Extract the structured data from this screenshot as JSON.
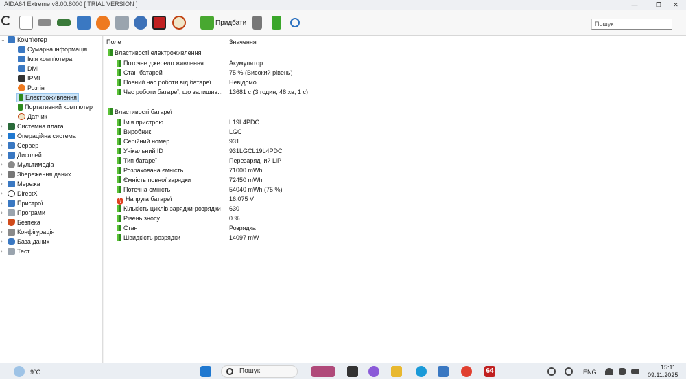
{
  "window": {
    "title": "AIDA64 Extreme v8.00.8000  [ TRIAL VERSION ]",
    "minimize": "—",
    "restore": "❐",
    "close": "✕"
  },
  "toolbar": {
    "add_label": "Придбати",
    "search_placeholder": "Пошук"
  },
  "tree": {
    "root": "Комп'ютер",
    "children": [
      "Сумарна інформація",
      "Ім'я комп'ютера",
      "DMI",
      "IPMI",
      "Розгін",
      "Електроживлення",
      "Портативний комп'ютер",
      "Датчик"
    ],
    "sections": [
      "Системна плата",
      "Операційна система",
      "Сервер",
      "Дисплей",
      "Мультимедіа",
      "Збереження даних",
      "Мережа",
      "DirectX",
      "Пристрої",
      "Програми",
      "Безпека",
      "Конфігурація",
      "База даних",
      "Тест"
    ]
  },
  "columns": {
    "field": "Поле",
    "value": "Значення"
  },
  "power": {
    "title": "Властивості електроживлення",
    "rows": [
      {
        "label": "Поточне джерело живлення",
        "value": "Акумулятор"
      },
      {
        "label": "Стан батарей",
        "value": "75 % (Високий рівень)"
      },
      {
        "label": "Повний час роботи від батареї",
        "value": "Невідомо"
      },
      {
        "label": "Час роботи батареї, що залишив...",
        "value": "13681 с (3 годин, 48 хв, 1 с)"
      }
    ]
  },
  "battery": {
    "title": "Властивості батареї",
    "rows": [
      {
        "label": "Ім'я пристрою",
        "value": "L19L4PDC"
      },
      {
        "label": "Виробник",
        "value": "LGC"
      },
      {
        "label": "Серійний номер",
        "value": "931"
      },
      {
        "label": "Унікальний ID",
        "value": "931LGCL19L4PDC"
      },
      {
        "label": "Тип батареї",
        "value": "Перезарядний LiP"
      },
      {
        "label": "Розрахована ємність",
        "value": "71000 mWh"
      },
      {
        "label": "Ємність повної зарядки",
        "value": "72450 mWh"
      },
      {
        "label": "Поточна ємність",
        "value": "54040 mWh  (75 %)"
      },
      {
        "label": "Напруга батареї",
        "value": "16.075 V"
      },
      {
        "label": "Кількість циклів зарядки-розрядки",
        "value": "630"
      },
      {
        "label": "Рівень зносу",
        "value": "0 %"
      },
      {
        "label": "Стан",
        "value": "Розрядка"
      },
      {
        "label": "Швидкість розрядки",
        "value": "14097 mW"
      }
    ]
  },
  "taskbar": {
    "weather": "9°C",
    "search": "Пошук",
    "lang": "ENG",
    "time": "15:11",
    "date": "09.11.2025",
    "aida_badge": "64"
  }
}
